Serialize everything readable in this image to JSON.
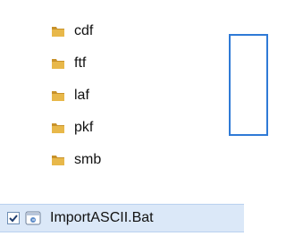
{
  "folders": [
    {
      "label": "cdf",
      "icon": "folder-icon"
    },
    {
      "label": "ftf",
      "icon": "folder-icon"
    },
    {
      "label": "laf",
      "icon": "folder-icon"
    },
    {
      "label": "pkf",
      "icon": "folder-icon"
    },
    {
      "label": "smb",
      "icon": "folder-icon"
    }
  ],
  "selected_file": {
    "label": "ImportASCII.Bat",
    "checked": true,
    "icon": "batch-file-icon"
  },
  "colors": {
    "folder": "#e8b84a",
    "folder_dark": "#c8922a",
    "selection_bg": "#dbe8f8",
    "panel_border": "#2f7ad6"
  }
}
